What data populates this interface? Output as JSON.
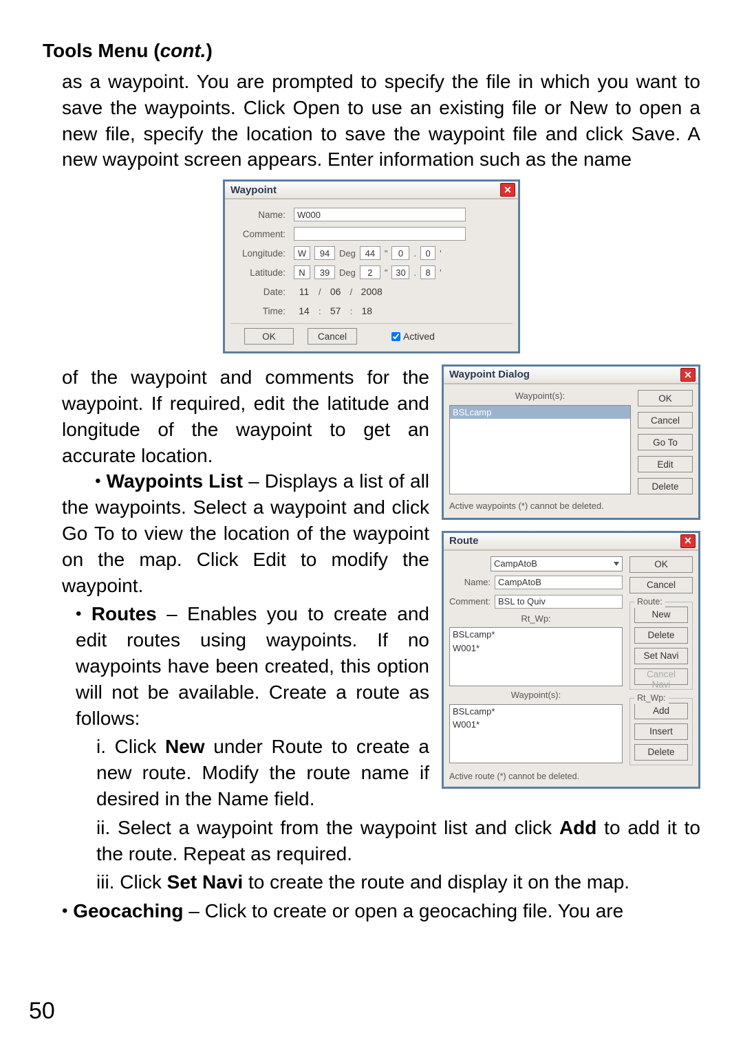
{
  "heading": {
    "prefix": "Tools Menu (",
    "italic": "cont.",
    "suffix": ")"
  },
  "page_number": "50",
  "text": {
    "p1": "as a waypoint. You are prompted to specify the file in which you want to save the waypoints. Click Open to use an existing file or New to open a new file, specify the location to save the waypoint file and click Save. A new waypoint screen appears. Enter information such as the name",
    "p2": "of the waypoint and comments for the waypoint. If required, edit the latitude and longitude of the waypoint to get an accurate location.",
    "wpl_label": "Waypoints List",
    "wpl_text_a": " – Displays a list of all the waypoints. Select a waypoint and click Go To to view the location of the ",
    "wpl_text_b": "waypoint on the map. Click Edit to modify the waypoint.",
    "routes_label": "Routes",
    "routes_text": " – Enables you to create and edit routes using waypoints. If  no waypoints have been created, this option will not be available. Create a route as follows:",
    "step_i_a": "i. Click ",
    "step_i_bold": "New",
    "step_i_b": " under Route to create a new route. Modify the route name if desired in the Name field.",
    "step_ii_a": "ii. Select a waypoint from the waypoint list and click ",
    "step_ii_bold": "Add",
    "step_ii_b": " to add it to the route. Repeat as required.",
    "step_iii_a": "iii. Click ",
    "step_iii_bold": "Set Navi",
    "step_iii_b": " to create the route and display it on the map.",
    "geo_label": "Geocaching",
    "geo_text": " – Click to create or open a geocaching file. You are",
    "bullet": "•"
  },
  "dlg_wp": {
    "title": "Waypoint",
    "labels": {
      "name": "Name:",
      "comment": "Comment:",
      "longitude": "Longitude:",
      "latitude": "Latitude:",
      "date": "Date:",
      "time": "Time:",
      "deg": "Deg",
      "quote": "\"",
      "dot": ".",
      "apos": "'",
      "slash": "/",
      "colon": ":"
    },
    "name": "W000",
    "comment": "",
    "lon": {
      "hemi": "W",
      "deg": "94",
      "min": "44",
      "sec": "0",
      "frac": "0"
    },
    "lat": {
      "hemi": "N",
      "deg": "39",
      "min": "2",
      "sec": "30",
      "frac": "8"
    },
    "date": {
      "m": "11",
      "d": "06",
      "y": "2008"
    },
    "time": {
      "h": "14",
      "m": "57",
      "s": "18"
    },
    "ok": "OK",
    "cancel": "Cancel",
    "actived": "Actived"
  },
  "dlg_wplist": {
    "title": "Waypoint Dialog",
    "listHeader": "Waypoint(s):",
    "items": [
      "BSLcamp"
    ],
    "buttons": {
      "ok": "OK",
      "cancel": "Cancel",
      "goto": "Go To",
      "edit": "Edit",
      "delete": "Delete"
    },
    "footnote": "Active waypoints (*) cannot be deleted."
  },
  "dlg_route": {
    "title": "Route",
    "routeSel": "CampAtoB",
    "nameLabel": "Name:",
    "name": "CampAtoB",
    "commentLabel": "Comment:",
    "comment": "BSL to Quiv",
    "rtwpLabel": "Rt_Wp:",
    "rtwp": [
      "BSLcamp*",
      "W001*"
    ],
    "wplLabel": "Waypoint(s):",
    "wpl": [
      "BSLcamp*",
      "W001*"
    ],
    "buttons": {
      "ok": "OK",
      "cancel": "Cancel",
      "new": "New",
      "delete": "Delete",
      "setnavi": "Set Navi",
      "cancelnavi": "Cancel Navi",
      "add": "Add",
      "insert": "Insert",
      "delete2": "Delete"
    },
    "groups": {
      "route": "Route:",
      "rtwp": "Rt_Wp:"
    },
    "footnote": "Active route (*) cannot be deleted."
  }
}
